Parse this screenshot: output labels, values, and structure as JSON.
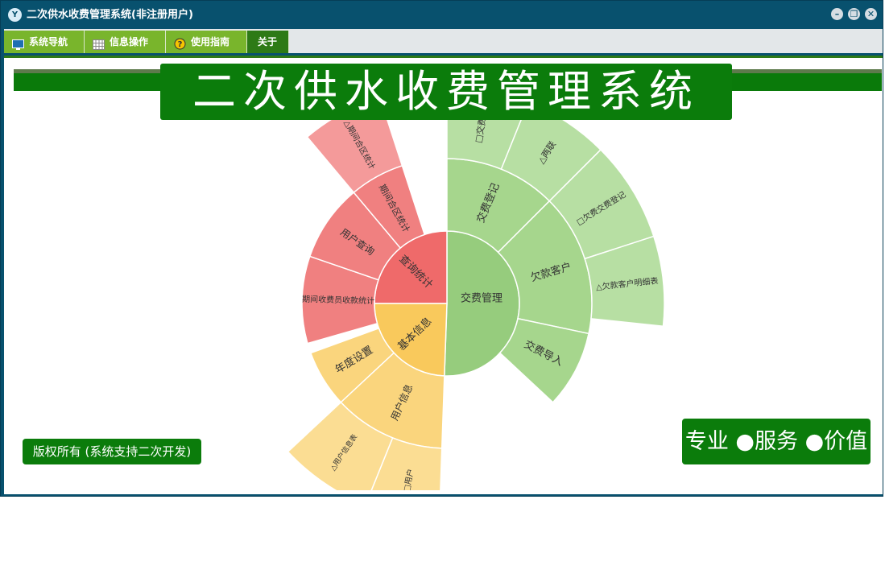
{
  "window": {
    "title": "二次供水收费管理系统(非注册用户)",
    "app_icon": "ys-logo-icon"
  },
  "menu": {
    "items": [
      {
        "label": "系统导航",
        "icon": "monitor-icon"
      },
      {
        "label": "信息操作",
        "icon": "grid-icon"
      },
      {
        "label": "使用指南",
        "icon": "help-icon"
      },
      {
        "label": "关于",
        "icon": ""
      }
    ]
  },
  "banner": {
    "title": "二次供水收费管理系统"
  },
  "footer": {
    "copyright": "版权所有 (系统支持二次开发)",
    "slogan": "专业 ●服务 ●价值"
  },
  "sunburst": {
    "center_labels": {
      "fee_mgmt": "交费管理",
      "query_stats": "查询统计",
      "basic_info": "基本信息"
    },
    "ring2": {
      "fee_register": "交费登记",
      "arrears_customer": "欠款客户",
      "fee_import": "交费导入",
      "period_stats": "期间合区统计",
      "user_query": "用户查询",
      "collector_stats": "期间收费员收款统计",
      "year_setting": "年度设置",
      "user_info": "用户信息"
    },
    "ring3": {
      "fee_register_leaf": "□交费登",
      "two_copies": "△两联",
      "arrears_register": "□欠费交费登记",
      "arrears_detail": "△欠款客户明细表",
      "period_stats_leaf": "△期间合区统计",
      "user_info_table": "△用户信息表",
      "user_leaf": "□用户"
    },
    "colors": {
      "green_inner": "#96cc7d",
      "green_mid": "#a6d68d",
      "green_outer": "#b7dfa3",
      "red_inner": "#ef6a6a",
      "red_mid": "#f08080",
      "red_outer": "#f49a9a",
      "yellow_inner": "#f9c95c",
      "yellow_mid": "#fad57d",
      "yellow_outer": "#fbdd93"
    }
  }
}
